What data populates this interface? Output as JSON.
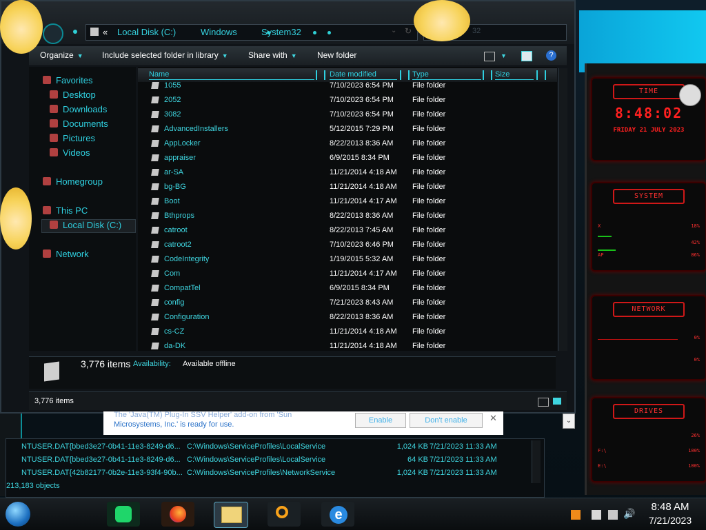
{
  "address": {
    "overflow": "«",
    "crumbs": [
      "Local Disk (C:)",
      "Windows",
      "System32"
    ],
    "search_hint": "32"
  },
  "toolbar": {
    "organize": "Organize",
    "include": "Include selected folder in library",
    "share": "Share with",
    "new_folder": "New folder"
  },
  "nav": {
    "favorites": "Favorites",
    "desktop": "Desktop",
    "downloads": "Downloads",
    "documents": "Documents",
    "pictures": "Pictures",
    "videos": "Videos",
    "homegroup": "Homegroup",
    "this_pc": "This PC",
    "local_disk": "Local Disk (C:)",
    "network": "Network"
  },
  "columns": {
    "name": "Name",
    "date": "Date modified",
    "type": "Type",
    "size": "Size"
  },
  "files": [
    {
      "name": "1055",
      "date": "7/10/2023 6:54 PM",
      "type": "File folder"
    },
    {
      "name": "2052",
      "date": "7/10/2023 6:54 PM",
      "type": "File folder"
    },
    {
      "name": "3082",
      "date": "7/10/2023 6:54 PM",
      "type": "File folder"
    },
    {
      "name": "AdvancedInstallers",
      "date": "5/12/2015 7:29 PM",
      "type": "File folder"
    },
    {
      "name": "AppLocker",
      "date": "8/22/2013 8:36 AM",
      "type": "File folder"
    },
    {
      "name": "appraiser",
      "date": "6/9/2015 8:34 PM",
      "type": "File folder"
    },
    {
      "name": "ar-SA",
      "date": "11/21/2014 4:18 AM",
      "type": "File folder"
    },
    {
      "name": "bg-BG",
      "date": "11/21/2014 4:18 AM",
      "type": "File folder"
    },
    {
      "name": "Boot",
      "date": "11/21/2014 4:17 AM",
      "type": "File folder"
    },
    {
      "name": "Bthprops",
      "date": "8/22/2013 8:36 AM",
      "type": "File folder"
    },
    {
      "name": "catroot",
      "date": "8/22/2013 7:45 AM",
      "type": "File folder"
    },
    {
      "name": "catroot2",
      "date": "7/10/2023 6:46 PM",
      "type": "File folder"
    },
    {
      "name": "CodeIntegrity",
      "date": "1/19/2015 5:32 AM",
      "type": "File folder"
    },
    {
      "name": "Com",
      "date": "11/21/2014 4:17 AM",
      "type": "File folder"
    },
    {
      "name": "CompatTel",
      "date": "6/9/2015 8:34 PM",
      "type": "File folder"
    },
    {
      "name": "config",
      "date": "7/21/2023 8:43 AM",
      "type": "File folder"
    },
    {
      "name": "Configuration",
      "date": "8/22/2013 8:36 AM",
      "type": "File folder"
    },
    {
      "name": "cs-CZ",
      "date": "11/21/2014 4:18 AM",
      "type": "File folder"
    },
    {
      "name": "da-DK",
      "date": "11/21/2014 4:18 AM",
      "type": "File folder"
    }
  ],
  "details": {
    "count": "3,776 items",
    "availability_label": "Availability:",
    "availability_value": "Available offline"
  },
  "status": {
    "count": "3,776 items"
  },
  "notification": {
    "line1": "The 'Java(TM) Plug-In SSV Helper' add-on from 'Sun",
    "line2": "Microsystems, Inc.' is ready for use.",
    "enable": "Enable",
    "dont_enable": "Don't enable",
    "close": "✕"
  },
  "downloads": {
    "rows": [
      {
        "name": "NTUSER.DAT{bbed3e27-0b41-11e3-8249-d6...",
        "path": "C:\\Windows\\ServiceProfiles\\LocalService",
        "size": "1,024 KB",
        "date": "7/21/2023 11:33 AM"
      },
      {
        "name": "NTUSER.DAT{bbed3e27-0b41-11e3-8249-d6...",
        "path": "C:\\Windows\\ServiceProfiles\\LocalService",
        "size": "64 KB",
        "date": "7/21/2023 11:33 AM"
      },
      {
        "name": "NTUSER.DAT{42b82177-0b2e-11e3-93f4-90b...",
        "path": "C:\\Windows\\ServiceProfiles\\NetworkService",
        "size": "1,024 KB",
        "date": "7/21/2023 11:33 AM"
      }
    ],
    "objects": "213,183 objects"
  },
  "gadget": {
    "time_title": "TIME",
    "time": "8:48:02",
    "date": "FRIDAY 21 JULY 2023",
    "system_title": "SYSTEM",
    "system_rows": [
      {
        "label": "X",
        "value": "18%"
      },
      {
        "label": "",
        "value": "42%"
      },
      {
        "label": "AP",
        "value": "86%"
      }
    ],
    "network_title": "NETWORK",
    "network_rows": [
      {
        "label": "",
        "value": "0%"
      },
      {
        "label": "",
        "value": "0%"
      }
    ],
    "drives_title": "DRIVES",
    "drive_rows": [
      {
        "label": "",
        "value": "26%"
      },
      {
        "label": "F:\\",
        "value": "100%"
      },
      {
        "label": "E:\\",
        "value": "100%"
      }
    ]
  },
  "clock": {
    "time": "8:48 AM",
    "date": "7/21/2023"
  },
  "colors": {
    "accent": "#3fd6e0",
    "gadget_red": "#ff2020",
    "bg": "#0b1a22"
  }
}
